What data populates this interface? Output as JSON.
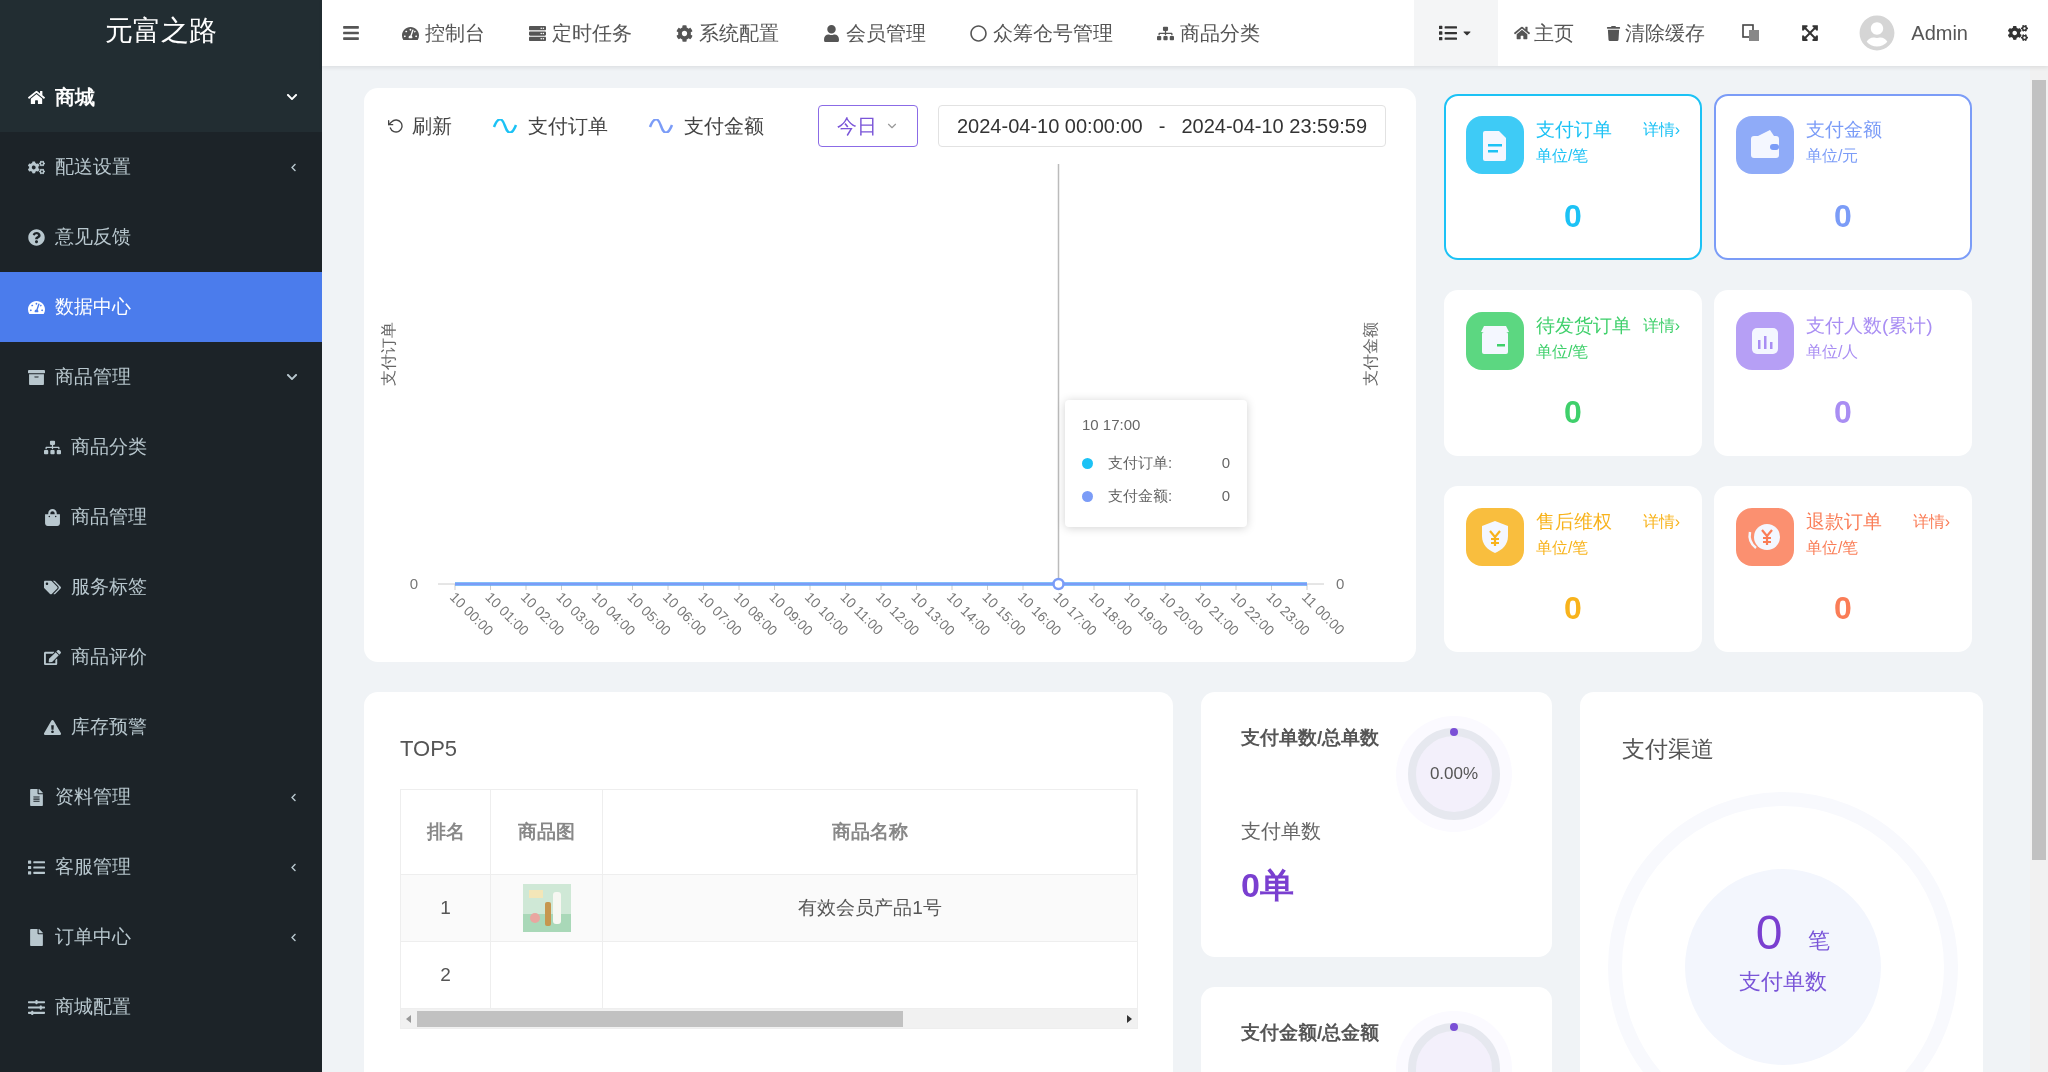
{
  "sidebar": {
    "title": "元富之路",
    "items": [
      {
        "label": "商城",
        "kind": "header",
        "expanded": true,
        "selected": false
      },
      {
        "label": "配送设置",
        "kind": "link",
        "expanded": false,
        "selected": false
      },
      {
        "label": "意见反馈",
        "kind": "link",
        "selected": false
      },
      {
        "label": "数据中心",
        "kind": "link",
        "selected": true
      },
      {
        "label": "商品管理",
        "kind": "link",
        "expanded": true,
        "selected": false,
        "children": [
          {
            "label": "商品分类",
            "selected": false
          },
          {
            "label": "商品管理",
            "selected": false
          },
          {
            "label": "服务标签",
            "selected": false
          },
          {
            "label": "商品评价",
            "selected": false
          },
          {
            "label": "库存预警",
            "selected": false
          }
        ]
      },
      {
        "label": "资料管理",
        "kind": "link",
        "expanded": false,
        "selected": false
      },
      {
        "label": "客服管理",
        "kind": "link",
        "expanded": false,
        "selected": false
      },
      {
        "label": "订单中心",
        "kind": "link",
        "expanded": false,
        "selected": false
      },
      {
        "label": "商城配置",
        "kind": "link",
        "selected": false
      }
    ]
  },
  "top_nav": {
    "items": [
      "控制台",
      "定时任务",
      "系统配置",
      "会员管理",
      "众筹仓号管理",
      "商品分类"
    ],
    "home": "主页",
    "clear_cache": "清除缓存",
    "user": "Admin"
  },
  "chart_panel": {
    "refresh": "刷新",
    "period": "今日",
    "date_range": {
      "start": "2024-04-10 00:00:00",
      "separator": "-",
      "end": "2024-04-10 23:59:59"
    },
    "right_axis_label": "支付金额",
    "left_tick": "0",
    "right_tick": "0",
    "tooltip": {
      "title": "10 17:00",
      "rows": [
        {
          "label": "支付订单:",
          "value": "0",
          "color": "#1cc2f5"
        },
        {
          "label": "支付金额:",
          "value": "0",
          "color": "#7b9cf7"
        }
      ]
    },
    "left_axis_label": "支付订单",
    "legend": [
      {
        "name": "支付订单",
        "color": "#1cc2f5"
      },
      {
        "name": "支付金额",
        "color": "#7b9cf7"
      }
    ],
    "x_labels": [
      "10 00:00",
      "10 01:00",
      "10 02:00",
      "10 03:00",
      "10 04:00",
      "10 05:00",
      "10 06:00",
      "10 07:00",
      "10 08:00",
      "10 09:00",
      "10 10:00",
      "10 11:00",
      "10 12:00",
      "10 13:00",
      "10 14:00",
      "10 15:00",
      "10 16:00",
      "10 17:00",
      "10 18:00",
      "10 19:00",
      "10 20:00",
      "10 21:00",
      "10 22:00",
      "10 23:00",
      "11 00:00"
    ]
  },
  "stat_cards": [
    {
      "title": "支付订单",
      "unit": "单位/笔",
      "value": "0",
      "detail": "详情›",
      "color": "#1cc2f5",
      "selected": true
    },
    {
      "title": "支付金额",
      "unit": "单位/元",
      "value": "0",
      "color": "#7b9cf7",
      "selected": true
    },
    {
      "title": "待发货订单",
      "unit": "单位/笔",
      "value": "0",
      "detail": "详情›",
      "color": "#3fd06b",
      "selected": false
    },
    {
      "title": "支付人数(累计)",
      "unit": "单位/人",
      "value": "0",
      "color": "#a98ef3",
      "selected": false
    },
    {
      "title": "售后维权",
      "unit": "单位/笔",
      "value": "0",
      "detail": "详情›",
      "color": "#f8b31c",
      "selected": false
    },
    {
      "title": "退款订单",
      "unit": "单位/笔",
      "value": "0",
      "detail": "详情›",
      "color": "#fa7d57",
      "selected": false
    }
  ],
  "top5": {
    "title": "TOP5",
    "columns": [
      "排名",
      "商品图",
      "商品名称"
    ],
    "rows": [
      {
        "rank": "1",
        "picture": true,
        "name": "有效会员产品1号"
      },
      {
        "rank": "2",
        "picture": false
      }
    ]
  },
  "ratio_cards": [
    {
      "title": "支付单数/总单数",
      "percent": "0.00%",
      "label": "支付单数",
      "value": "0单",
      "level": 0
    },
    {
      "title": "支付金额/总金额",
      "level": 0
    }
  ],
  "payment_channel": {
    "title": "支付渠道",
    "value": "0",
    "unit": "笔",
    "label": "支付单数"
  }
}
